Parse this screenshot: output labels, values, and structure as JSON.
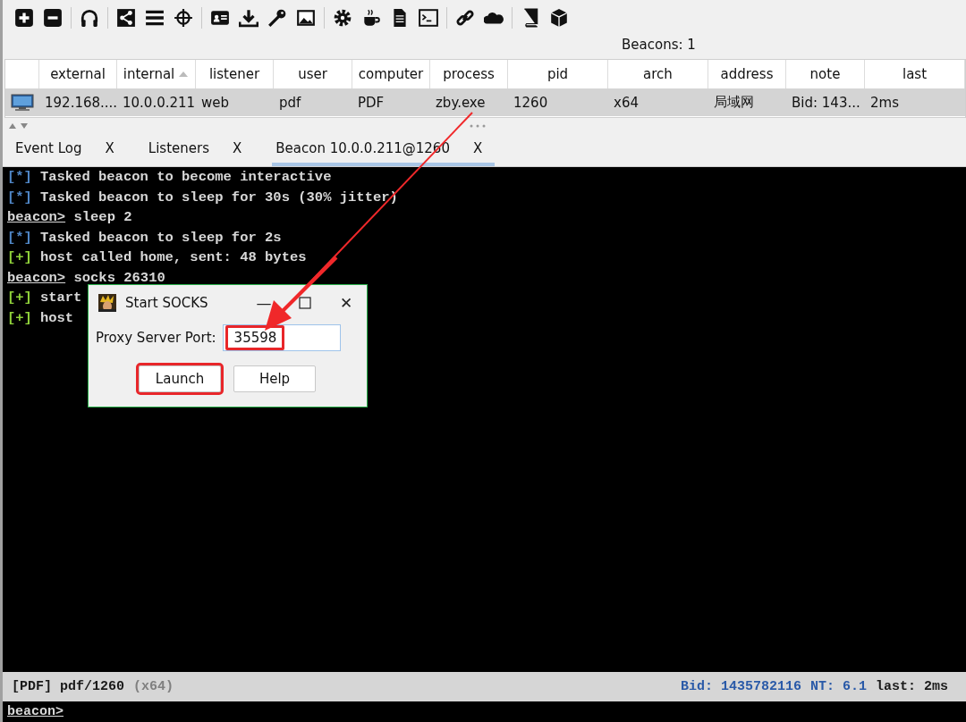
{
  "beacon_count": "Beacons: 1",
  "table": {
    "columns": [
      {
        "label": "external",
        "sorted": false
      },
      {
        "label": "internal",
        "sorted": true
      },
      {
        "label": "listener",
        "sorted": false
      },
      {
        "label": "user",
        "sorted": false
      },
      {
        "label": "computer",
        "sorted": false
      },
      {
        "label": "process",
        "sorted": false
      },
      {
        "label": "pid",
        "sorted": false
      },
      {
        "label": "arch",
        "sorted": false
      },
      {
        "label": "address",
        "sorted": false
      },
      {
        "label": "note",
        "sorted": false
      },
      {
        "label": "last",
        "sorted": false
      }
    ],
    "rows": [
      {
        "selected": true,
        "cells": [
          "192.168....",
          "10.0.0.211",
          "web",
          "pdf",
          "PDF",
          "zby.exe",
          "1260",
          "x64",
          "局域网",
          "Bid: 143...",
          "2ms"
        ]
      }
    ]
  },
  "tabs": [
    {
      "label": "Event Log",
      "close": "X",
      "selected": false
    },
    {
      "label": "Listeners",
      "close": "X",
      "selected": false
    },
    {
      "label": "Beacon 10.0.0.211@1260",
      "close": "X",
      "selected": true
    }
  ],
  "console": {
    "lines": [
      {
        "kind": "info",
        "mark": "[*]",
        "text": "Tasked beacon to become interactive"
      },
      {
        "kind": "info",
        "mark": "[*]",
        "text": "Tasked beacon to sleep for 30s (30% jitter)"
      },
      {
        "kind": "prompt",
        "mark": "beacon>",
        "text": "sleep 2"
      },
      {
        "kind": "info",
        "mark": "[*]",
        "text": "Tasked beacon to sleep for 2s"
      },
      {
        "kind": "ok",
        "mark": "[+]",
        "text": "host called home, sent: 48 bytes"
      },
      {
        "kind": "prompt",
        "mark": "beacon>",
        "text": "socks 26310"
      },
      {
        "kind": "ok",
        "mark": "[+]",
        "text": "start"
      },
      {
        "kind": "ok",
        "mark": "[+]",
        "text": "host"
      }
    ]
  },
  "status_bar": {
    "left": [
      {
        "text": "[PDF] pdf/1260",
        "color": "#1a1a1a"
      },
      {
        "text": "(x64)",
        "color": "#808080"
      }
    ],
    "right": [
      {
        "text": "Bid: 1435782116",
        "color": "#2a5aa8"
      },
      {
        "text": "NT: 6.1",
        "color": "#2a5aa8"
      },
      {
        "text": "last: 2ms",
        "color": "#1a1a1a"
      }
    ]
  },
  "input": {
    "prompt": "beacon>"
  },
  "dialog": {
    "title": "Start SOCKS",
    "minimize": "—",
    "close": "✕",
    "label": "Proxy Server Port:",
    "value": "35598",
    "value_highlighted": true,
    "buttons": [
      {
        "label": "Launch",
        "highlighted": true
      },
      {
        "label": "Help",
        "highlighted": false
      }
    ]
  }
}
